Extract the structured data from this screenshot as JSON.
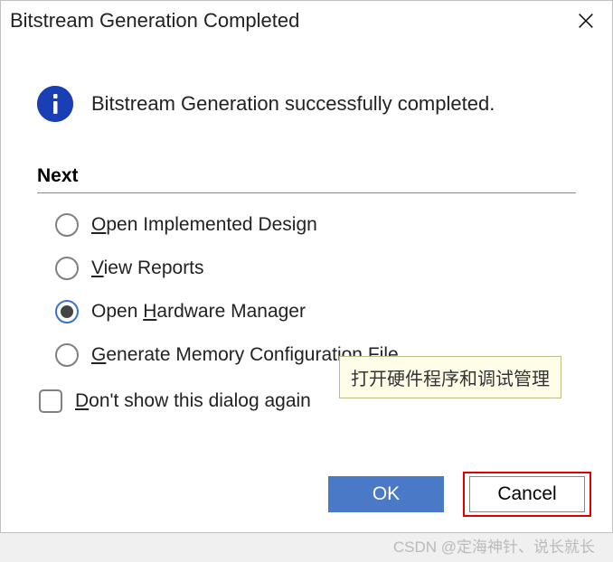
{
  "titlebar": {
    "title": "Bitstream Generation Completed"
  },
  "message": "Bitstream Generation successfully completed.",
  "section_label": "Next",
  "options": [
    {
      "pre": "",
      "u": "O",
      "post": "pen Implemented Design",
      "selected": false
    },
    {
      "pre": "",
      "u": "V",
      "post": "iew Reports",
      "selected": false
    },
    {
      "pre": "Open ",
      "u": "H",
      "post": "ardware Manager",
      "selected": true
    },
    {
      "pre": "",
      "u": "G",
      "post": "enerate Memory Configuration File",
      "selected": false
    }
  ],
  "checkbox": {
    "pre": "",
    "u": "D",
    "post": "on't show this dialog again"
  },
  "tooltip": "打开硬件程序和调试管理",
  "buttons": {
    "ok": "OK",
    "cancel": "Cancel"
  },
  "watermark": "CSDN @定海神针、说长就长",
  "icons": {
    "info": "info-icon",
    "close": "close-icon"
  }
}
